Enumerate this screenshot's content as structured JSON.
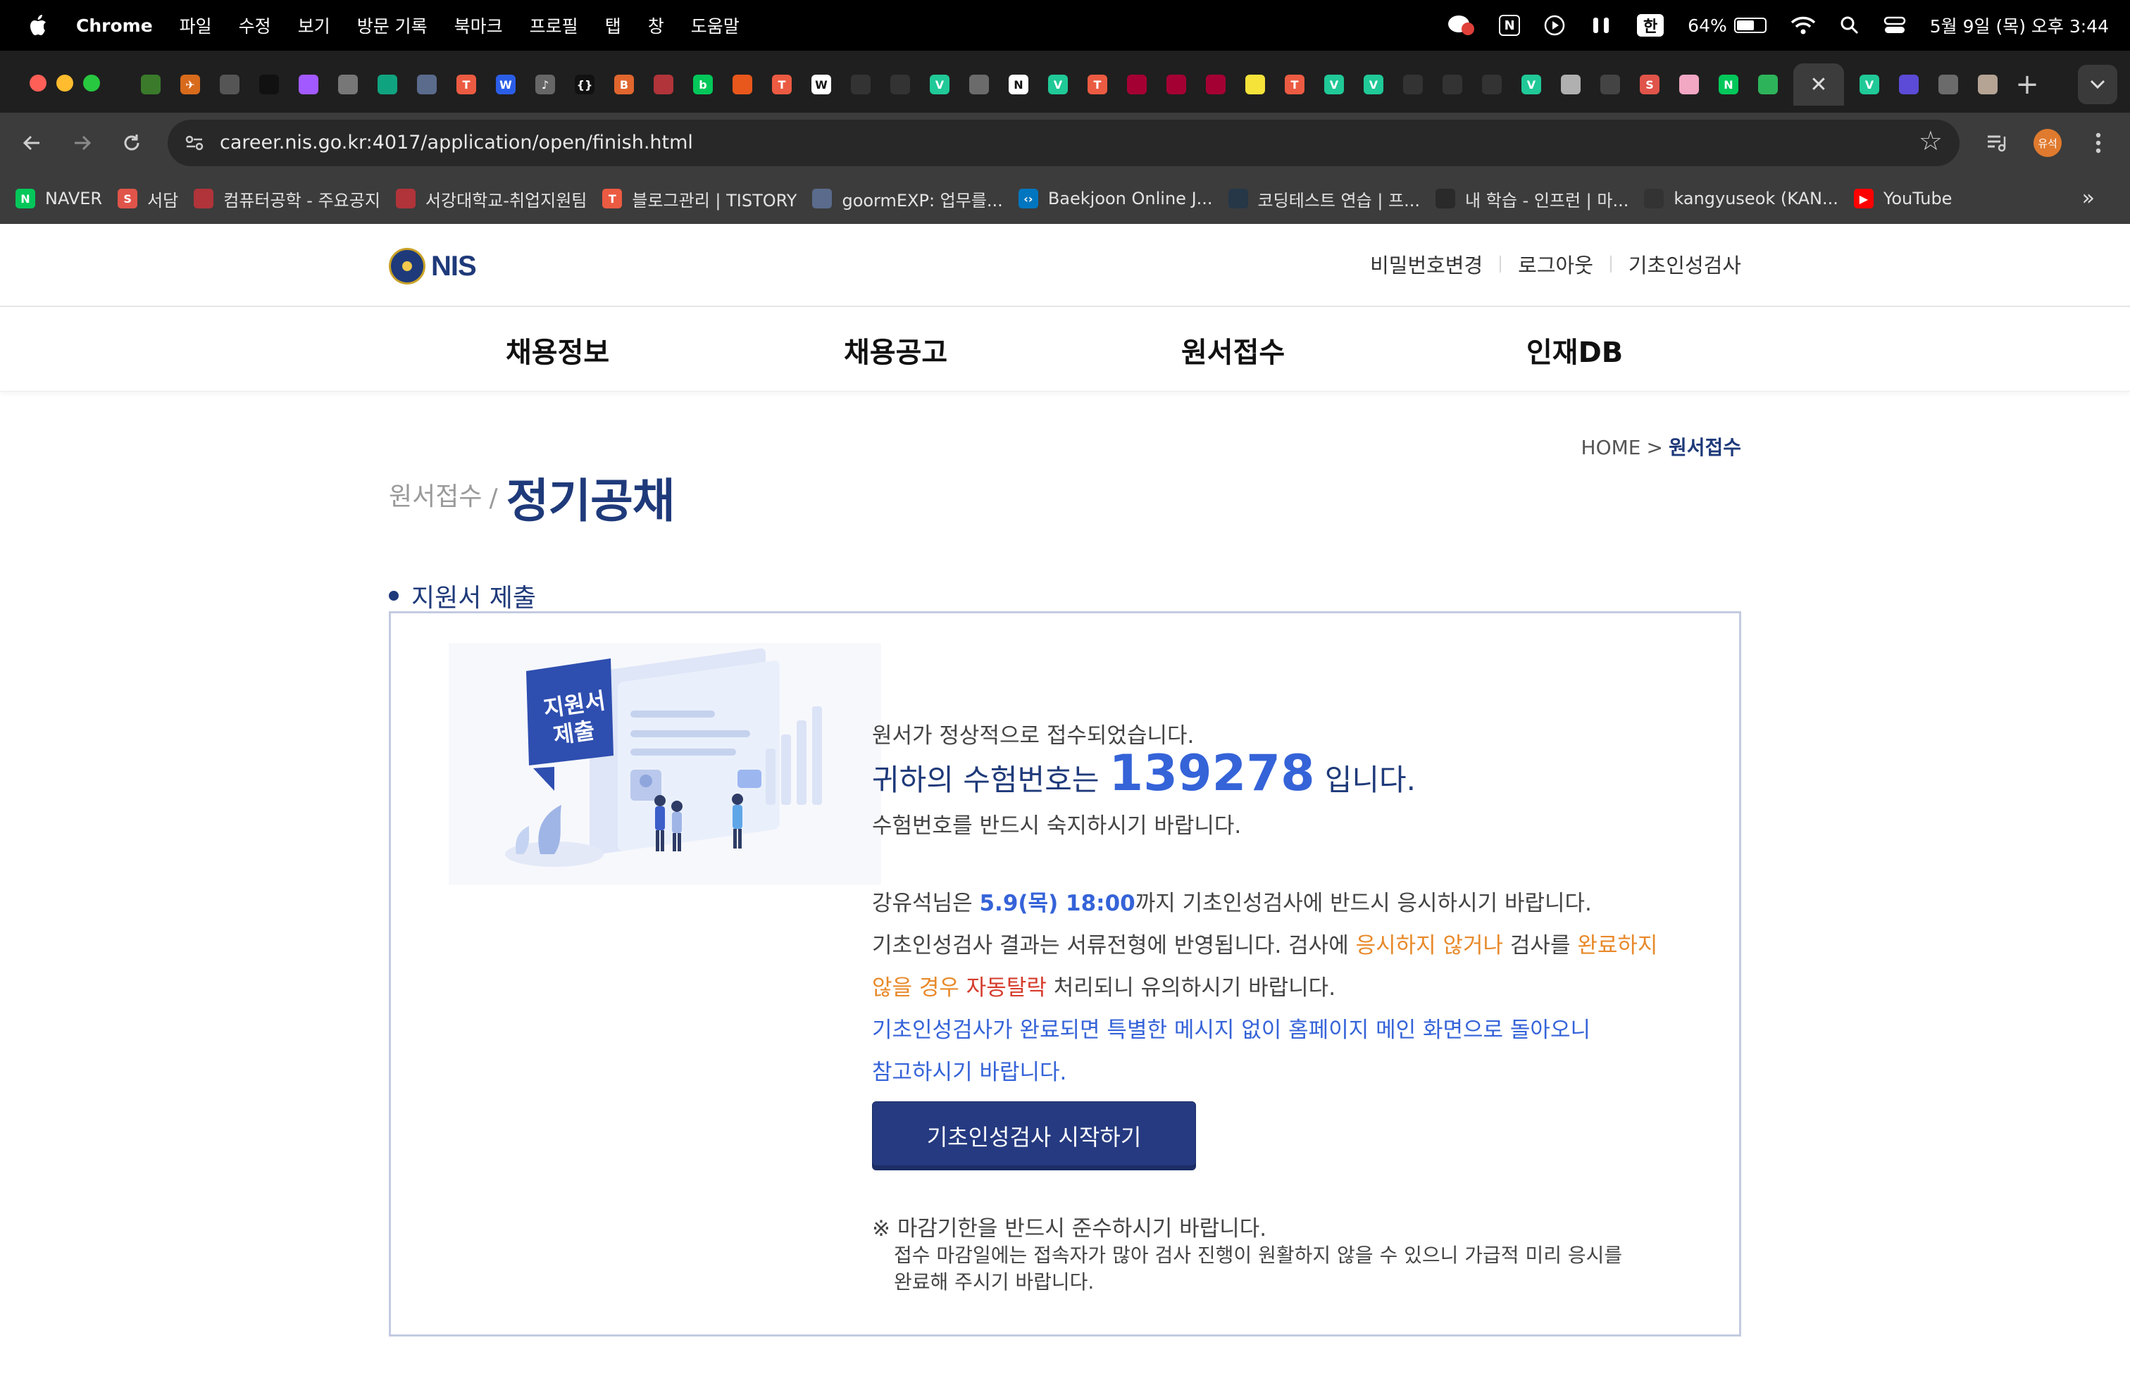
{
  "menubar": {
    "app_name": "Chrome",
    "menus": [
      "파일",
      "수정",
      "보기",
      "방문 기록",
      "북마크",
      "프로필",
      "탭",
      "창",
      "도움말"
    ],
    "status": {
      "ime": "한",
      "battery_text": "64%",
      "battery_level": 0.64,
      "datetime": "5월 9일 (목) 오후 3:44"
    }
  },
  "tabstrip": {
    "active_tab_close": "✕",
    "new_tab": "+",
    "favicons": [
      {
        "icon": "palm-tree-favicon",
        "color": "#3a7a2a",
        "glyph": ""
      },
      {
        "icon": "plane-favicon",
        "color": "#d86a1c",
        "glyph": "✈"
      },
      {
        "icon": "film-favicon",
        "color": "#555555",
        "glyph": ""
      },
      {
        "icon": "dark-favicon",
        "color": "#111111",
        "glyph": ""
      },
      {
        "icon": "figma-favicon",
        "color": "#a259ff",
        "glyph": ""
      },
      {
        "icon": "person-favicon",
        "color": "#777777",
        "glyph": ""
      },
      {
        "icon": "chatgpt-favicon",
        "color": "#10a37f",
        "glyph": ""
      },
      {
        "icon": "monitor-favicon",
        "color": "#5a6b8c",
        "glyph": ""
      },
      {
        "icon": "tistory-favicon",
        "color": "#eb5b42",
        "glyph": "T"
      },
      {
        "icon": "w-favicon",
        "color": "#2b5ee8",
        "glyph": "W"
      },
      {
        "icon": "speaker-favicon",
        "color": "#666666",
        "glyph": "♪"
      },
      {
        "icon": "bracket-favicon",
        "color": "#111111",
        "glyph": "{}"
      },
      {
        "icon": "b-favicon",
        "color": "#e0662e",
        "glyph": "B"
      },
      {
        "icon": "crest-favicon",
        "color": "#b0343a",
        "glyph": ""
      },
      {
        "icon": "blog-favicon",
        "color": "#03c75a",
        "glyph": "b"
      },
      {
        "icon": "orange-favicon",
        "color": "#e8571b",
        "glyph": ""
      },
      {
        "icon": "tistory-favicon",
        "color": "#eb5b42",
        "glyph": "T"
      },
      {
        "icon": "wikipedia-favicon",
        "color": "#ffffff",
        "glyph": "W"
      },
      {
        "icon": "github-favicon",
        "color": "#333333",
        "glyph": ""
      },
      {
        "icon": "github-favicon",
        "color": "#333333",
        "glyph": ""
      },
      {
        "icon": "v-favicon",
        "color": "#20c997",
        "glyph": "V"
      },
      {
        "icon": "globe-favicon",
        "color": "#6b6b6b",
        "glyph": ""
      },
      {
        "icon": "notion-favicon",
        "color": "#ffffff",
        "glyph": "N"
      },
      {
        "icon": "v-favicon",
        "color": "#20c997",
        "glyph": "V"
      },
      {
        "icon": "tistory-favicon",
        "color": "#eb5b42",
        "glyph": "T"
      },
      {
        "icon": "lg-favicon",
        "color": "#a50034",
        "glyph": ""
      },
      {
        "icon": "lg-favicon",
        "color": "#a50034",
        "glyph": ""
      },
      {
        "icon": "lg-favicon",
        "color": "#a50034",
        "glyph": ""
      },
      {
        "icon": "lilys-favicon",
        "color": "#f5e33a",
        "glyph": ""
      },
      {
        "icon": "tistory-favicon",
        "color": "#eb5b42",
        "glyph": "T"
      },
      {
        "icon": "v-favicon",
        "color": "#20c997",
        "glyph": "V"
      },
      {
        "icon": "v-favicon",
        "color": "#20c997",
        "glyph": "V"
      },
      {
        "icon": "github-favicon",
        "color": "#333333",
        "glyph": ""
      },
      {
        "icon": "github-favicon",
        "color": "#333333",
        "glyph": ""
      },
      {
        "icon": "github-favicon",
        "color": "#333333",
        "glyph": ""
      },
      {
        "icon": "v-favicon",
        "color": "#20c997",
        "glyph": "V"
      },
      {
        "icon": "cup-favicon",
        "color": "#b0b0b0",
        "glyph": ""
      },
      {
        "icon": "bug-favicon",
        "color": "#444444",
        "glyph": ""
      },
      {
        "icon": "s-favicon",
        "color": "#e0544a",
        "glyph": "S"
      },
      {
        "icon": "bunny-favicon",
        "color": "#f2a7c3",
        "glyph": ""
      },
      {
        "icon": "naver-favicon",
        "color": "#03c75a",
        "glyph": "N"
      },
      {
        "icon": "mail-favicon",
        "color": "#2db45b",
        "glyph": ""
      }
    ],
    "after_active": [
      {
        "icon": "v-favicon",
        "color": "#20c997",
        "glyph": "V"
      },
      {
        "icon": "stack-favicon",
        "color": "#5b4bd6",
        "glyph": ""
      },
      {
        "icon": "globe-favicon",
        "color": "#6b6b6b",
        "glyph": ""
      },
      {
        "icon": "circle-favicon",
        "color": "#b5a394",
        "glyph": ""
      }
    ]
  },
  "toolbar": {
    "url": "career.nis.go.kr:4017/application/open/finish.html",
    "profile_initials": "유석"
  },
  "bookmarks": [
    {
      "label": "NAVER",
      "icon": "naver-icon",
      "color": "#03c75a",
      "glyph": "N"
    },
    {
      "label": "서담",
      "icon": "s-icon",
      "color": "#e0544a",
      "glyph": "S"
    },
    {
      "label": "컴퓨터공학 - 주요공지",
      "icon": "crest-icon",
      "color": "#b0343a",
      "glyph": ""
    },
    {
      "label": "서강대학교-취업지원팀",
      "icon": "crest-icon",
      "color": "#b0343a",
      "glyph": ""
    },
    {
      "label": "블로그관리 | TISTORY",
      "icon": "tistory-icon",
      "color": "#eb5b42",
      "glyph": "T"
    },
    {
      "label": "goormEXP: 업무를...",
      "icon": "monitor-icon",
      "color": "#5a6b8c",
      "glyph": ""
    },
    {
      "label": "Baekjoon Online J...",
      "icon": "code-icon",
      "color": "#0076c0",
      "glyph": "‹›"
    },
    {
      "label": "코딩테스트 연습 | 프...",
      "icon": "programmers-icon",
      "color": "#263747",
      "glyph": ""
    },
    {
      "label": "내 학습 - 인프런 | 마...",
      "icon": "inflearn-icon",
      "color": "#2a2a2a",
      "glyph": ""
    },
    {
      "label": "kangyuseok (KAN...",
      "icon": "github-icon",
      "color": "#333333",
      "glyph": ""
    },
    {
      "label": "YouTube",
      "icon": "youtube-icon",
      "color": "#ff0000",
      "glyph": "▶"
    }
  ],
  "bookmarks_more": "»",
  "site": {
    "logo_text": "NIS",
    "util_links": [
      "비밀번호변경",
      "로그아웃",
      "기초인성검사"
    ],
    "gnb": [
      "채용정보",
      "채용공고",
      "원서접수",
      "인재DB"
    ],
    "breadcrumb": {
      "home": "HOME",
      "sep": ">",
      "current": "원서접수"
    },
    "page_sub": "원서접수",
    "page_slash": "/",
    "page_title": "정기공채",
    "section_title": "지원서 제출"
  },
  "finish": {
    "illustration_label_line1": "지원서",
    "illustration_label_line2": "제출",
    "line1": "원서가 정상적으로 접수되었습니다.",
    "exam_prefix": "귀하의 수험번호는",
    "exam_number": "139278",
    "exam_suffix": "입니다.",
    "line3": "수험번호를 반드시 숙지하시기 바랍니다.",
    "p1_a": "강유석님은 ",
    "p1_deadline": "5.9(목) 18:00",
    "p1_b": "까지 기초인성검사에 반드시 응시하시기 바랍니다.",
    "p2_a": "기초인성검사 결과는 서류전형에 반영됩니다. 검사에 ",
    "p2_orange1": "응시하지 않거나",
    "p2_b": " 검사를 ",
    "p2_orange2": "완료하지",
    "p3_orange": "않을 경우",
    "p3_red": " 자동탈락",
    "p3_b": " 처리되니 유의하시기 바랍니다.",
    "p4": "기초인성검사가 완료되면 특별한 메시지 없이 홈페이지 메인 화면으로 돌아오니",
    "p5": "참고하시기 바랍니다.",
    "button_label": "기초인성검사 시작하기",
    "note_title": "※ 마감기한을 반드시 준수하시기 바랍니다.",
    "note_line1": "접수 마감일에는 접속자가 많아 검사 진행이 원활하지 않을 수 있으니 가급적 미리 응시를",
    "note_line2": "완료해 주시기 바랍니다."
  },
  "colors": {
    "brand_navy": "#1f3a7a",
    "accent_blue": "#3563d8",
    "warn_orange": "#e8892a",
    "alert_red": "#d63b2b",
    "button_bg": "#253a80"
  }
}
